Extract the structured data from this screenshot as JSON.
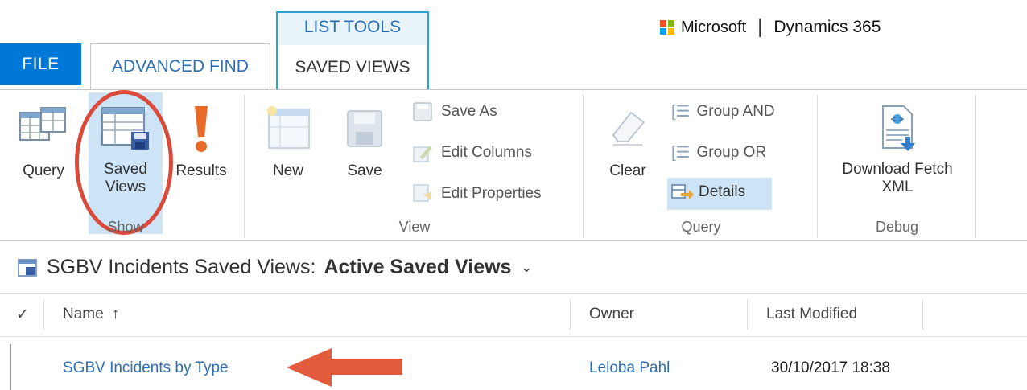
{
  "tabs": {
    "file": "FILE",
    "advanced_find": "ADVANCED FIND",
    "context_group": "LIST TOOLS",
    "saved_views": "SAVED VIEWS"
  },
  "brand": {
    "microsoft": "Microsoft",
    "separator": "|",
    "product": "Dynamics 365",
    "logo_colors": [
      "#f25022",
      "#7fba00",
      "#00a4ef",
      "#ffb900"
    ]
  },
  "ribbon": {
    "show": {
      "label": "Show",
      "query": "Query",
      "saved_views_line1": "Saved",
      "saved_views_line2": "Views",
      "results": "Results"
    },
    "view": {
      "label": "View",
      "new": "New",
      "save": "Save",
      "save_as": "Save As",
      "edit_columns": "Edit Columns",
      "edit_properties": "Edit Properties"
    },
    "query": {
      "label": "Query",
      "clear": "Clear",
      "group_and": "Group AND",
      "group_or": "Group OR",
      "details": "Details"
    },
    "debug": {
      "label": "Debug",
      "download_line1": "Download Fetch",
      "download_line2": "XML"
    }
  },
  "view": {
    "prefix": "SGBV Incidents Saved Views:",
    "active": "Active Saved Views"
  },
  "grid": {
    "columns": {
      "name": "Name",
      "owner": "Owner",
      "modified": "Last Modified"
    },
    "rows": [
      {
        "name": "SGBV Incidents by Type",
        "owner": "Leloba Pahl",
        "modified": "30/10/2017 18:38"
      }
    ]
  },
  "colors": {
    "accent": "#0078d7",
    "highlight": "#cde4f7",
    "annotation": "#d94a3a",
    "link": "#2a6fb3"
  }
}
